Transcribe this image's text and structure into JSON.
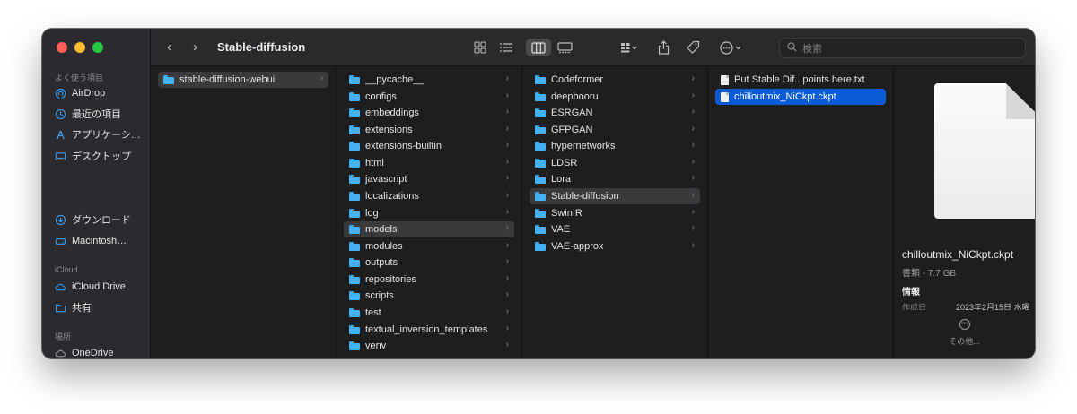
{
  "window": {
    "title": "Stable-diffusion"
  },
  "sidebar": {
    "sections": [
      {
        "label": "よく使う項目"
      },
      {
        "label": "iCloud"
      },
      {
        "label": "場所"
      }
    ],
    "items": [
      {
        "label": "AirDrop",
        "icon": "airdrop-icon"
      },
      {
        "label": "最近の項目",
        "icon": "clock-icon"
      },
      {
        "label": "アプリケーシ…",
        "icon": "applications-icon"
      },
      {
        "label": "デスクトップ",
        "icon": "desktop-icon"
      },
      {
        "label": "ダウンロード",
        "icon": "download-icon"
      },
      {
        "label": "Macintosh…",
        "icon": "drive-icon"
      },
      {
        "label": "iCloud Drive",
        "icon": "cloud-icon"
      },
      {
        "label": "共有",
        "icon": "shared-folder-icon"
      },
      {
        "label": "OneDrive",
        "icon": "cloud-icon"
      }
    ]
  },
  "toolbar": {
    "back": "‹",
    "forward": "›",
    "search_placeholder": "検索"
  },
  "columns": [
    {
      "items": [
        {
          "name": "stable-diffusion-webui",
          "type": "folder",
          "state": "open"
        }
      ]
    },
    {
      "items": [
        {
          "name": "__pycache__",
          "type": "folder"
        },
        {
          "name": "configs",
          "type": "folder"
        },
        {
          "name": "embeddings",
          "type": "folder"
        },
        {
          "name": "extensions",
          "type": "folder"
        },
        {
          "name": "extensions-builtin",
          "type": "folder"
        },
        {
          "name": "html",
          "type": "folder"
        },
        {
          "name": "javascript",
          "type": "folder"
        },
        {
          "name": "localizations",
          "type": "folder"
        },
        {
          "name": "log",
          "type": "folder"
        },
        {
          "name": "models",
          "type": "folder",
          "state": "open"
        },
        {
          "name": "modules",
          "type": "folder"
        },
        {
          "name": "outputs",
          "type": "folder"
        },
        {
          "name": "repositories",
          "type": "folder"
        },
        {
          "name": "scripts",
          "type": "folder"
        },
        {
          "name": "test",
          "type": "folder"
        },
        {
          "name": "textual_inversion_templates",
          "type": "folder"
        },
        {
          "name": "venv",
          "type": "folder"
        }
      ]
    },
    {
      "items": [
        {
          "name": "Codeformer",
          "type": "folder"
        },
        {
          "name": "deepbooru",
          "type": "folder"
        },
        {
          "name": "ESRGAN",
          "type": "folder"
        },
        {
          "name": "GFPGAN",
          "type": "folder"
        },
        {
          "name": "hypernetworks",
          "type": "folder"
        },
        {
          "name": "LDSR",
          "type": "folder"
        },
        {
          "name": "Lora",
          "type": "folder"
        },
        {
          "name": "Stable-diffusion",
          "type": "folder",
          "state": "open"
        },
        {
          "name": "SwinIR",
          "type": "folder"
        },
        {
          "name": "VAE",
          "type": "folder"
        },
        {
          "name": "VAE-approx",
          "type": "folder"
        }
      ]
    },
    {
      "items": [
        {
          "name": "Put Stable Dif...points here.txt",
          "type": "file"
        },
        {
          "name": "chilloutmix_NiCkpt.ckpt",
          "type": "file",
          "state": "selected"
        }
      ]
    }
  ],
  "preview": {
    "name": "chilloutmix_NiCkpt.ckpt",
    "kind": "書類 - 7.7 GB",
    "info_heading": "情報",
    "created_label": "作成日",
    "created_value": "2023年2月15日 水曜",
    "more_label": "その他..."
  },
  "colors": {
    "selection": "#0a5cd6",
    "folder": "#43b1f2"
  }
}
